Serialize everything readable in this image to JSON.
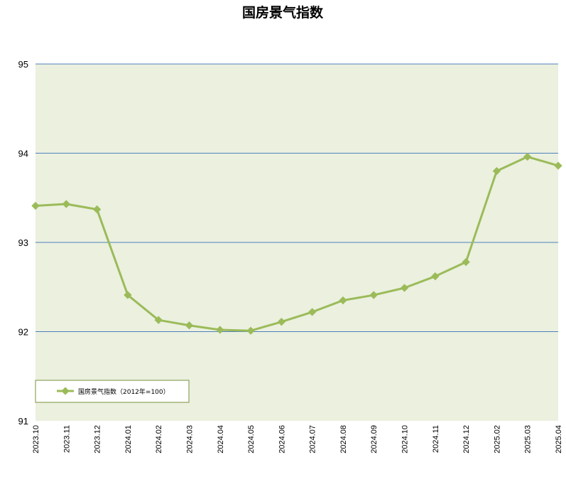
{
  "chart_data": {
    "type": "line",
    "title": "国房景气指数",
    "xlabel": "",
    "ylabel": "",
    "ylim": [
      91,
      95
    ],
    "yticks": [
      "91",
      "92",
      "93",
      "94",
      "95"
    ],
    "categories": [
      "2023.10",
      "2023.11",
      "2023.12",
      "2024.01",
      "2024.02",
      "2024.03",
      "2024.04",
      "2024.05",
      "2024.06",
      "2024.07",
      "2024.08",
      "2024.09",
      "2024.10",
      "2024.11",
      "2024.12",
      "2025.02",
      "2025.03",
      "2025.04"
    ],
    "series": [
      {
        "name": "国房景气指数（2012年=100）",
        "values": [
          93.41,
          93.43,
          93.37,
          92.41,
          92.13,
          92.07,
          92.02,
          92.01,
          92.11,
          92.22,
          92.35,
          92.41,
          92.49,
          92.62,
          92.78,
          93.8,
          93.96,
          93.86
        ]
      }
    ],
    "grid": true,
    "legend": "bottom-left",
    "colors": {
      "plot_bg": "#ebf0df",
      "line": "#9bbb59",
      "grid": "#4f81bd",
      "legend_border": "#77933c"
    }
  }
}
